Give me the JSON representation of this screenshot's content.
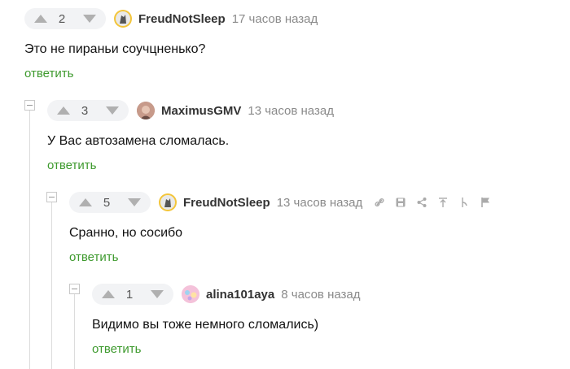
{
  "comments": [
    {
      "rating": "2",
      "author": "FreudNotSleep",
      "time": "17 часов назад",
      "text": "Это не пираньи соучцненько?",
      "reply": "ответить",
      "avatar": "freud-avatar-icon"
    },
    {
      "rating": "3",
      "author": "MaximusGMV",
      "time": "13 часов назад",
      "text": "У Вас автозамена сломалась.",
      "reply": "ответить",
      "avatar": "maximus-avatar-icon"
    },
    {
      "rating": "5",
      "author": "FreudNotSleep",
      "time": "13 часов назад",
      "text": "Сранно, но сосибо",
      "reply": "ответить",
      "avatar": "freud-avatar-icon",
      "actions": [
        "link-icon",
        "save-icon",
        "share-icon",
        "scroll-top-icon",
        "branch-icon",
        "report-flag-icon"
      ]
    },
    {
      "rating": "1",
      "author": "alina101aya",
      "time": "8 часов назад",
      "text": "Видимо вы тоже немного сломались)",
      "reply": "ответить",
      "avatar": "alina-avatar-icon"
    }
  ],
  "colors": {
    "reply": "#3e9a2e",
    "author": "#333333",
    "time": "#8a8a8a"
  }
}
